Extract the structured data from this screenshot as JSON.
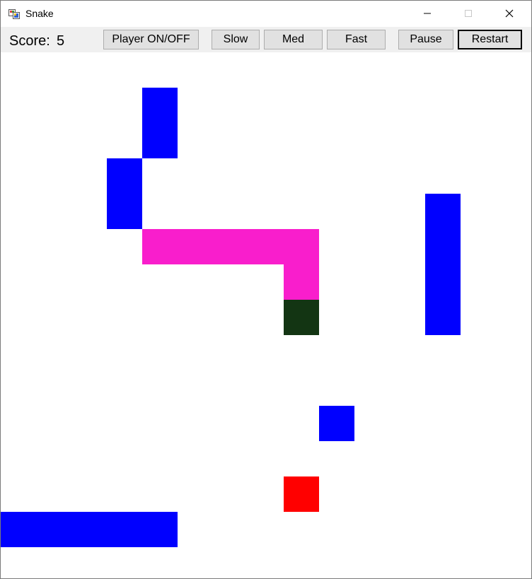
{
  "window": {
    "title": "Snake",
    "icon": "app-window-icon",
    "controls": [
      "minimize-icon",
      "maximize-icon",
      "close-icon"
    ]
  },
  "toolbar": {
    "score_label": "Score:",
    "score_value": "5",
    "buttons": {
      "player": "Player ON/OFF",
      "slow": "Slow",
      "med": "Med",
      "fast": "Fast",
      "pause": "Pause",
      "restart": "Restart"
    }
  },
  "colors": {
    "obstacle": "#0000ff",
    "snake_body": "#f91ecc",
    "snake_head": "#133513",
    "food": "#ff0000",
    "toolbar_bg": "#f0f0f0",
    "board_bg": "#ffffff"
  }
}
